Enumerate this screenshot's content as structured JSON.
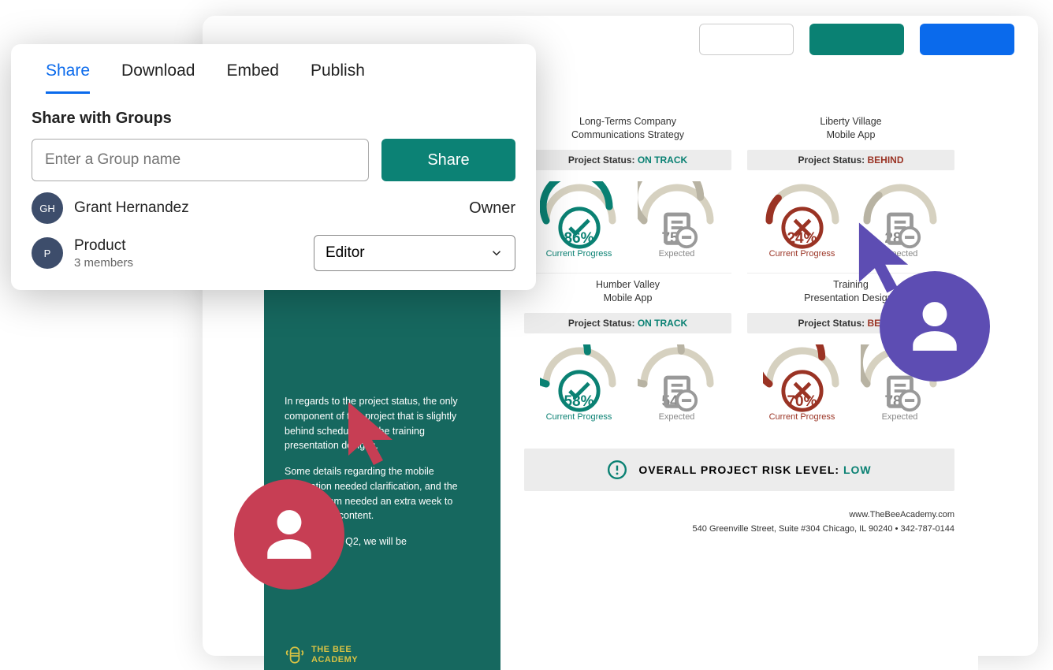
{
  "popover": {
    "tabs": [
      "Share",
      "Download",
      "Embed",
      "Publish"
    ],
    "active_tab": 0,
    "section_title": "Share with Groups",
    "input_placeholder": "Enter a Group name",
    "share_button": "Share",
    "members": [
      {
        "avatar": "GH",
        "name": "Grant Hernandez",
        "sub": "",
        "role": "Owner",
        "editable": false
      },
      {
        "avatar": "P",
        "name": "Product",
        "sub": "3 members",
        "role": "Editor",
        "editable": true
      }
    ]
  },
  "document": {
    "left_paragraphs": [
      "In regards to the project status, the only component of this project that is slightly behind schedule are the training presentation designs.",
      "Some details regarding the mobile application needed clarification, and the product team needed an extra week to provide that content.",
      "By the end of Q2, we will be"
    ],
    "logo_line1": "THE BEE",
    "logo_line2": "ACADEMY",
    "projects": [
      {
        "title_line1": "Long-Terms Company",
        "title_line2": "Communications Strategy",
        "status_label": "Project Status:",
        "status_value": "ON TRACK",
        "status_class": "on",
        "current_pct": 86,
        "current_label": "Current Progress",
        "current_color": "teal",
        "icon": "check",
        "expected_pct": 75,
        "expected_label": "Expected"
      },
      {
        "title_line1": "Liberty Village",
        "title_line2": "Mobile App",
        "status_label": "Project Status:",
        "status_value": "BEHIND",
        "status_class": "behind",
        "current_pct": 24,
        "current_label": "Current Progress",
        "current_color": "red",
        "icon": "x",
        "expected_pct": 28,
        "expected_label": "Expected"
      },
      {
        "title_line1": "Humber Valley",
        "title_line2": "Mobile App",
        "status_label": "Project Status:",
        "status_value": "ON TRACK",
        "status_class": "on",
        "current_pct": 58,
        "current_label": "Current Progress",
        "current_color": "teal",
        "icon": "check",
        "expected_pct": 54,
        "expected_label": "Expected"
      },
      {
        "title_line1": "Training",
        "title_line2": "Presentation Designs",
        "status_label": "Project Status:",
        "status_value": "BEHIND",
        "status_class": "behind",
        "current_pct": 70,
        "current_label": "Current Progress",
        "current_color": "red",
        "icon": "x",
        "expected_pct": 78,
        "expected_label": "Expected"
      }
    ],
    "risk": {
      "label": "OVERALL PROJECT RISK LEVEL:",
      "value": "LOW"
    },
    "footer": {
      "url": "www.TheBeeAcademy.com",
      "address": "540 Greenville Street, Suite #304 Chicago, IL 90240 • 342-787-0144"
    }
  },
  "colors": {
    "teal": "#0a8173",
    "red": "#9a3324",
    "gray": "#b8b3a3",
    "purple": "#5d4db3",
    "rose": "#c73e54"
  }
}
